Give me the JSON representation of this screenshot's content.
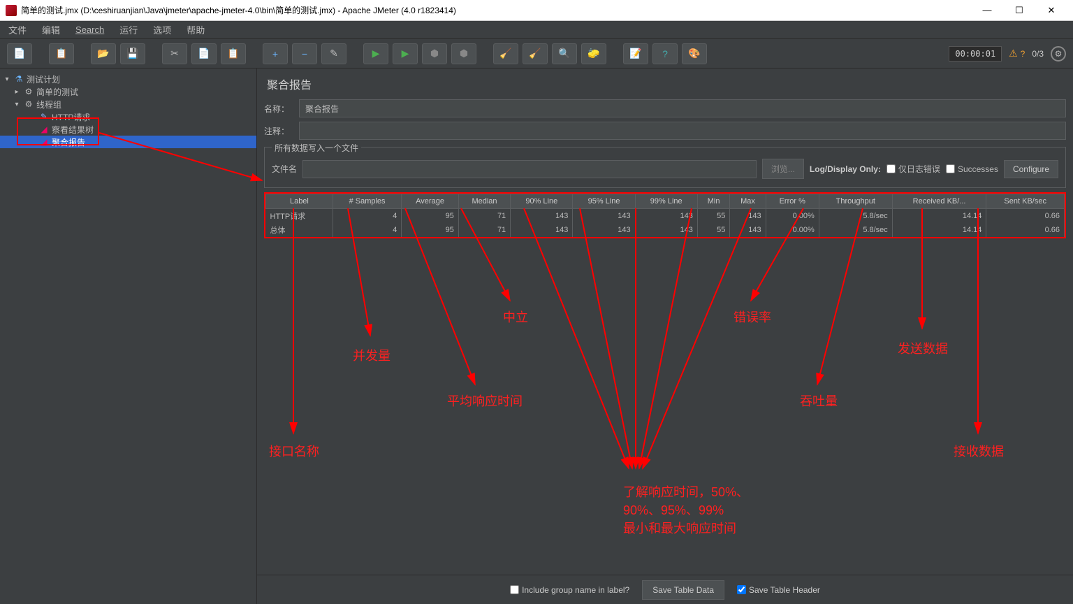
{
  "window": {
    "title": "简单的测试.jmx (D:\\ceshiruanjian\\Java\\jmeter\\apache-jmeter-4.0\\bin\\简单的测试.jmx) - Apache JMeter (4.0 r1823414)"
  },
  "menu": {
    "file": "文件",
    "edit": "编辑",
    "search": "Search",
    "run": "运行",
    "options": "选项",
    "help": "帮助"
  },
  "toolbar": {
    "timer": "00:00:01",
    "warn_count": "?",
    "thread_count": "0/3"
  },
  "tree": {
    "root": "测试计划",
    "n1": "简单的测试",
    "n2": "线程组",
    "n3": "HTTP请求",
    "n4": "察看结果树",
    "n5": "聚合报告"
  },
  "panel": {
    "title": "聚合报告",
    "name_label": "名称：",
    "name_value": "聚合报告",
    "comment_label": "注释：",
    "fieldset": "所有数据写入一个文件",
    "filename_label": "文件名",
    "browse": "浏览...",
    "logonly": "Log/Display Only:",
    "errors_only": "仅日志错误",
    "successes": "Successes",
    "configure": "Configure"
  },
  "table": {
    "headers": [
      "Label",
      "# Samples",
      "Average",
      "Median",
      "90% Line",
      "95% Line",
      "99% Line",
      "Min",
      "Max",
      "Error %",
      "Throughput",
      "Received KB/...",
      "Sent KB/sec"
    ],
    "rows": [
      {
        "label": "HTTP请求",
        "samples": "4",
        "avg": "95",
        "median": "71",
        "p90": "143",
        "p95": "143",
        "p99": "143",
        "min": "55",
        "max": "143",
        "err": "0.00%",
        "tp": "5.8/sec",
        "recv": "14.14",
        "sent": "0.66"
      },
      {
        "label": "总体",
        "samples": "4",
        "avg": "95",
        "median": "71",
        "p90": "143",
        "p95": "143",
        "p99": "143",
        "min": "55",
        "max": "143",
        "err": "0.00%",
        "tp": "5.8/sec",
        "recv": "14.14",
        "sent": "0.66"
      }
    ]
  },
  "footer": {
    "include": "Include group name in label?",
    "save_data": "Save Table Data",
    "save_header": "Save Table Header"
  },
  "annot": {
    "a1": "接口名称",
    "a2": "并发量",
    "a3": "平均响应时间",
    "a4": "中立",
    "a5": "错误率",
    "a6": "吞吐量",
    "a7": "发送数据",
    "a8": "接收数据",
    "a9a": "了解响应时间，50%、",
    "a9b": "90%、95%、99%",
    "a9c": "最小和最大响应时间"
  }
}
